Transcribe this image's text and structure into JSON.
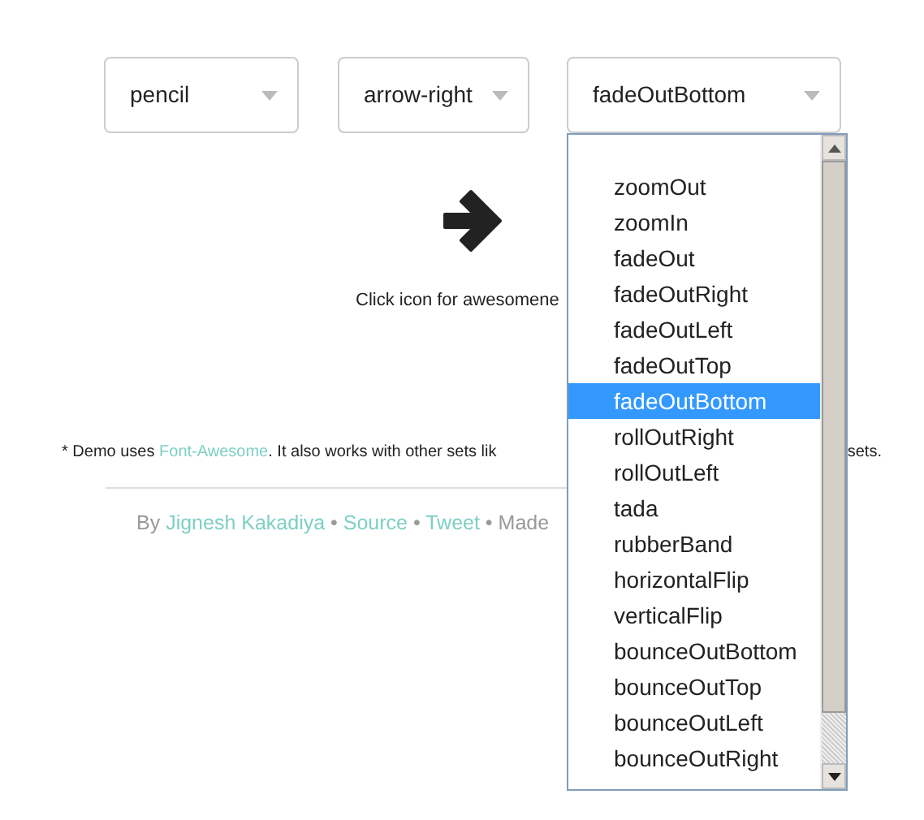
{
  "selects": [
    {
      "value": "pencil"
    },
    {
      "value": "arrow-right"
    },
    {
      "value": "fadeOutBottom"
    }
  ],
  "dropdown": {
    "open": true
  },
  "hint": "Click icon for awesomene",
  "note": {
    "prefix": "* Demo uses ",
    "link": "Font-Awesome",
    "suffix": ". It also works with other sets lik",
    "tail": "sets."
  },
  "footer": [
    {
      "kind": "text",
      "text": "By "
    },
    {
      "kind": "link",
      "text": "Jignesh Kakadiya"
    },
    {
      "kind": "text",
      "text": " • "
    },
    {
      "kind": "link",
      "text": "Source"
    },
    {
      "kind": "text",
      "text": " • "
    },
    {
      "kind": "link",
      "text": "Tweet"
    },
    {
      "kind": "text",
      "text": " • Made"
    }
  ],
  "options": [
    {
      "label": "zoomOut",
      "selected": false
    },
    {
      "label": "zoomIn",
      "selected": false
    },
    {
      "label": "fadeOut",
      "selected": false
    },
    {
      "label": "fadeOutRight",
      "selected": false
    },
    {
      "label": "fadeOutLeft",
      "selected": false
    },
    {
      "label": "fadeOutTop",
      "selected": false
    },
    {
      "label": "fadeOutBottom",
      "selected": true
    },
    {
      "label": "rollOutRight",
      "selected": false
    },
    {
      "label": "rollOutLeft",
      "selected": false
    },
    {
      "label": "tada",
      "selected": false
    },
    {
      "label": "rubberBand",
      "selected": false
    },
    {
      "label": "horizontalFlip",
      "selected": false
    },
    {
      "label": "verticalFlip",
      "selected": false
    },
    {
      "label": "bounceOutBottom",
      "selected": false
    },
    {
      "label": "bounceOutTop",
      "selected": false
    },
    {
      "label": "bounceOutLeft",
      "selected": false
    },
    {
      "label": "bounceOutRight",
      "selected": false
    }
  ]
}
